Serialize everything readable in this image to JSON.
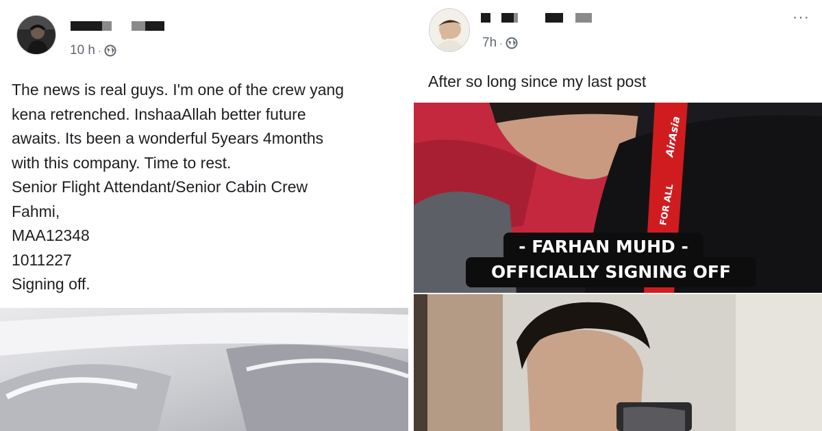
{
  "left_post": {
    "timestamp": "10 h",
    "separator": "·",
    "privacy_icon": "globe-icon",
    "lines": [
      "The news is real guys. I'm one of the crew yang",
      "kena retrenched. InshaaAllah better future",
      "awaits. Its been a wonderful 5years 4months",
      "with this company. Time to rest.",
      "Senior Flight Attendant/Senior Cabin Crew",
      "Fahmi,",
      "MAA12348",
      "1011227",
      "Signing off."
    ]
  },
  "right_post": {
    "timestamp": "7h",
    "separator": "·",
    "privacy_icon": "globe-icon",
    "more_label": "···",
    "text": "After so long since my last post",
    "photo_caption": {
      "line1": "- FARHAN MUHD -",
      "line2": "OFFICIALLY SIGNING OFF"
    },
    "lanyard_text": "FOR ALL",
    "lanyard_logo": "AirAsia"
  },
  "colors": {
    "text": "#1c1e21",
    "meta": "#606770",
    "caption_bg": "#0d0d0d",
    "lanyard_red": "#d01c1f"
  }
}
